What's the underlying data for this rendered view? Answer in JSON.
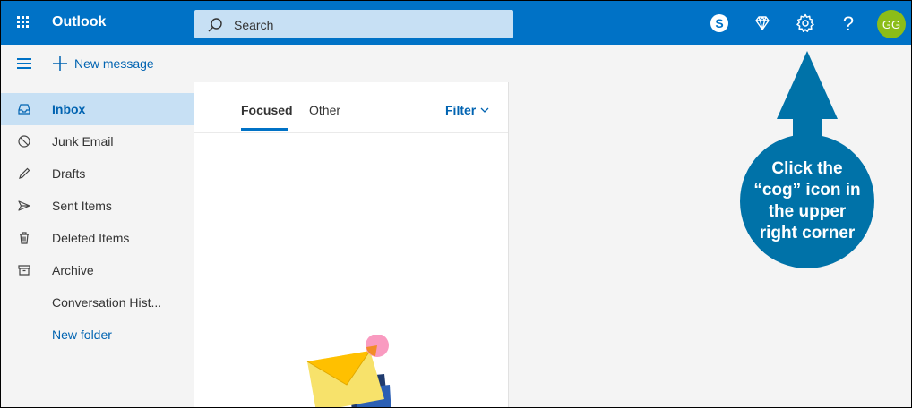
{
  "topbar": {
    "app_name": "Outlook",
    "search_placeholder": "Search",
    "avatar_initials": "GG",
    "icons": [
      "app-launcher-icon",
      "search-icon",
      "skype-icon",
      "premium-diamond-icon",
      "settings-cog-icon",
      "help-icon"
    ]
  },
  "commandbar": {
    "new_message_label": "New message"
  },
  "sidebar": {
    "items": [
      {
        "label": "Inbox",
        "icon": "inbox-icon",
        "selected": true
      },
      {
        "label": "Junk Email",
        "icon": "junk-icon"
      },
      {
        "label": "Drafts",
        "icon": "pencil-icon"
      },
      {
        "label": "Sent Items",
        "icon": "send-icon"
      },
      {
        "label": "Deleted Items",
        "icon": "trash-icon"
      },
      {
        "label": "Archive",
        "icon": "archive-icon"
      },
      {
        "label": "Conversation Hist..."
      },
      {
        "label": "New folder",
        "link": true
      }
    ]
  },
  "message_list": {
    "tabs": [
      {
        "label": "Focused",
        "active": true
      },
      {
        "label": "Other"
      }
    ],
    "filter_label": "Filter"
  },
  "callout": {
    "text": "Click the “cog” icon in the upper right corner"
  },
  "colors": {
    "brand_blue": "#0072c6",
    "callout_blue": "#0072a8",
    "avatar_green": "#8cbd18",
    "selected_bg": "#c7e0f4"
  }
}
